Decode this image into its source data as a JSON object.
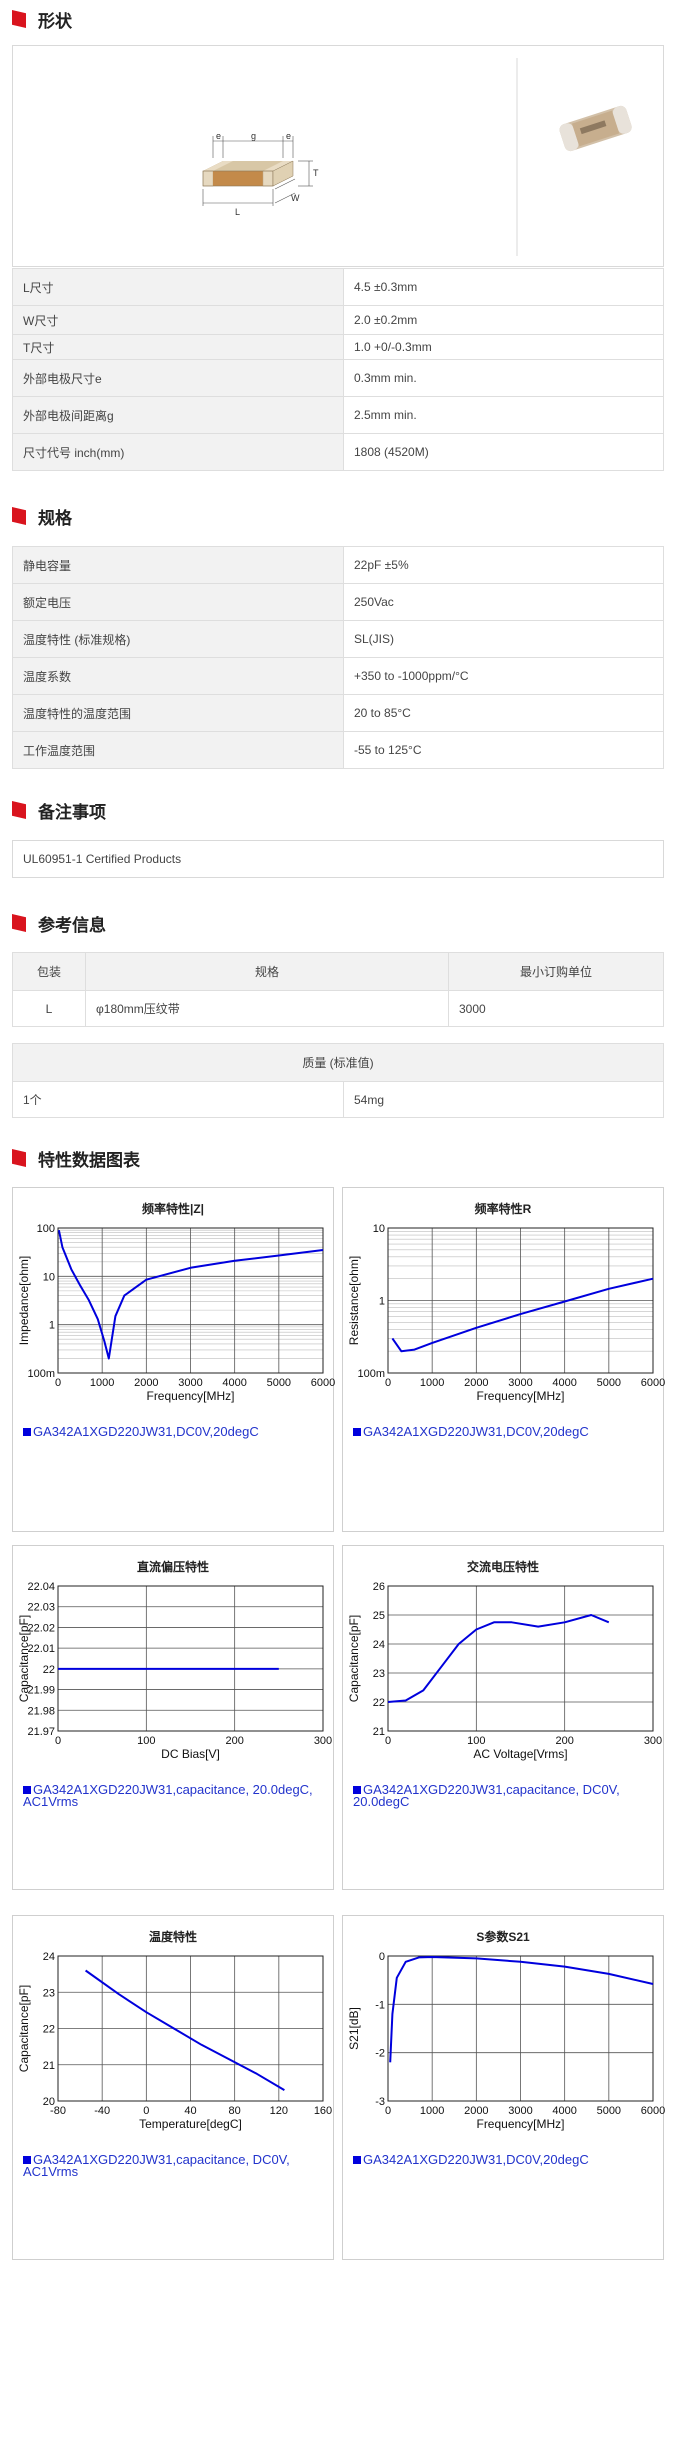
{
  "sections": {
    "shape": "形状",
    "spec": "规格",
    "notes": "备注事项",
    "reference": "参考信息",
    "charts": "特性数据图表"
  },
  "shape_diagram": {
    "e1": "e",
    "g": "g",
    "e2": "e",
    "T": "T",
    "L": "L",
    "W": "W"
  },
  "dimensions": [
    {
      "label": "L尺寸",
      "value": "4.5 ±0.3mm"
    },
    {
      "label": "W尺寸",
      "value": "2.0 ±0.2mm"
    },
    {
      "label": "T尺寸",
      "value": "1.0 +0/-0.3mm"
    },
    {
      "label": "外部电极尺寸e",
      "value": "0.3mm min."
    },
    {
      "label": "外部电极间距离g",
      "value": "2.5mm min."
    },
    {
      "label": "尺寸代号 inch(mm)",
      "value": "1808 (4520M)"
    }
  ],
  "specs": [
    {
      "label": "静电容量",
      "value": "22pF ±5%"
    },
    {
      "label": "额定电压",
      "value": "250Vac"
    },
    {
      "label": "温度特性 (标准规格)",
      "value": "SL(JIS)"
    },
    {
      "label": "温度系数",
      "value": "+350 to -1000ppm/°C"
    },
    {
      "label": "温度特性的温度范围",
      "value": "20 to 85°C"
    },
    {
      "label": "工作温度范围",
      "value": "-55 to 125°C"
    }
  ],
  "notes": {
    "text": "UL60951-1 Certified Products"
  },
  "packaging": {
    "headers": [
      "包装",
      "规格",
      "最小订购单位"
    ],
    "row": [
      "L",
      "φ180mm压纹带",
      "3000"
    ]
  },
  "mass": {
    "header": "质量 (标准值)",
    "row": [
      "1个",
      "54mg"
    ]
  },
  "chart_data": [
    {
      "type": "line",
      "title": "频率特性|Z|",
      "xlabel": "Frequency[MHz]",
      "ylabel": "Impedance[ohm]",
      "xlim": [
        0,
        6000
      ],
      "ylim": [
        0.1,
        100
      ],
      "yscale": "log",
      "xticks": [
        "0",
        "1000",
        "2000",
        "3000",
        "4000",
        "5000",
        "6000"
      ],
      "yticks": [
        "100",
        "10",
        "1",
        "100m"
      ],
      "x": [
        20,
        100,
        300,
        500,
        700,
        900,
        1050,
        1150,
        1300,
        1500,
        2000,
        3000,
        4000,
        5000,
        6000
      ],
      "y": [
        90,
        40,
        14,
        6.5,
        3.2,
        1.3,
        0.45,
        0.2,
        1.5,
        4.0,
        8.5,
        15,
        21,
        27,
        35
      ],
      "legend": "GA342A1XGD220JW31,DC0V,20degC"
    },
    {
      "type": "line",
      "title": "频率特性R",
      "xlabel": "Frequency[MHz]",
      "ylabel": "Resistance[ohm]",
      "xlim": [
        0,
        6000
      ],
      "ylim": [
        0.1,
        10
      ],
      "yscale": "log",
      "xticks": [
        "0",
        "1000",
        "2000",
        "3000",
        "4000",
        "5000",
        "6000"
      ],
      "yticks": [
        "10",
        "1",
        "100m"
      ],
      "x": [
        100,
        300,
        600,
        1000,
        2000,
        3000,
        4000,
        5000,
        6000
      ],
      "y": [
        0.3,
        0.2,
        0.21,
        0.26,
        0.42,
        0.65,
        0.97,
        1.45,
        2.0
      ],
      "legend": "GA342A1XGD220JW31,DC0V,20degC"
    },
    {
      "type": "line",
      "title": "直流偏压特性",
      "xlabel": "DC Bias[V]",
      "ylabel": "Capacitance[pF]",
      "xlim": [
        0,
        300
      ],
      "ylim": [
        21.97,
        22.04
      ],
      "xticks": [
        "0",
        "100",
        "200",
        "300"
      ],
      "yticks": [
        "22.04",
        "22.03",
        "22.02",
        "22.01",
        "22",
        "21.99",
        "21.98",
        "21.97"
      ],
      "x": [
        0,
        250
      ],
      "y": [
        22.0,
        22.0
      ],
      "legend": "GA342A1XGD220JW31,capacitance, 20.0degC, AC1Vrms"
    },
    {
      "type": "line",
      "title": "交流电压特性",
      "xlabel": "AC Voltage[Vrms]",
      "ylabel": "Capacitance[pF]",
      "xlim": [
        0,
        300
      ],
      "ylim": [
        21,
        26
      ],
      "xticks": [
        "0",
        "100",
        "200",
        "300"
      ],
      "yticks": [
        "26",
        "25",
        "24",
        "23",
        "22",
        "21"
      ],
      "x": [
        0,
        20,
        40,
        60,
        80,
        100,
        120,
        140,
        170,
        200,
        230,
        250
      ],
      "y": [
        22.0,
        22.05,
        22.4,
        23.2,
        24.0,
        24.5,
        24.75,
        24.75,
        24.6,
        24.75,
        25.0,
        24.75
      ],
      "legend": "GA342A1XGD220JW31,capacitance, DC0V, 20.0degC"
    },
    {
      "type": "line",
      "title": "温度特性",
      "xlabel": "Temperature[degC]",
      "ylabel": "Capacitance[pF]",
      "xlim": [
        -80,
        160
      ],
      "ylim": [
        20,
        24
      ],
      "xticks": [
        "-80",
        "-40",
        "0",
        "40",
        "80",
        "120",
        "160"
      ],
      "yticks": [
        "24",
        "23",
        "22",
        "21",
        "20"
      ],
      "x": [
        -55,
        -25,
        0,
        25,
        50,
        75,
        100,
        125
      ],
      "y": [
        23.6,
        22.95,
        22.45,
        22.0,
        21.55,
        21.15,
        20.75,
        20.3
      ],
      "legend": "GA342A1XGD220JW31,capacitance, DC0V, AC1Vrms"
    },
    {
      "type": "line",
      "title": "S参数S21",
      "xlabel": "Frequency[MHz]",
      "ylabel": "S21[dB]",
      "xlim": [
        0,
        6000
      ],
      "ylim": [
        -3,
        0
      ],
      "xticks": [
        "0",
        "1000",
        "2000",
        "3000",
        "4000",
        "5000",
        "6000"
      ],
      "yticks": [
        "0",
        "-1",
        "-2",
        "-3"
      ],
      "x": [
        50,
        100,
        200,
        400,
        700,
        1000,
        2000,
        3000,
        4000,
        5000,
        6000
      ],
      "y": [
        -2.2,
        -1.2,
        -0.45,
        -0.12,
        -0.03,
        -0.02,
        -0.05,
        -0.12,
        -0.22,
        -0.37,
        -0.58
      ],
      "legend": "GA342A1XGD220JW31,DC0V,20degC"
    }
  ]
}
